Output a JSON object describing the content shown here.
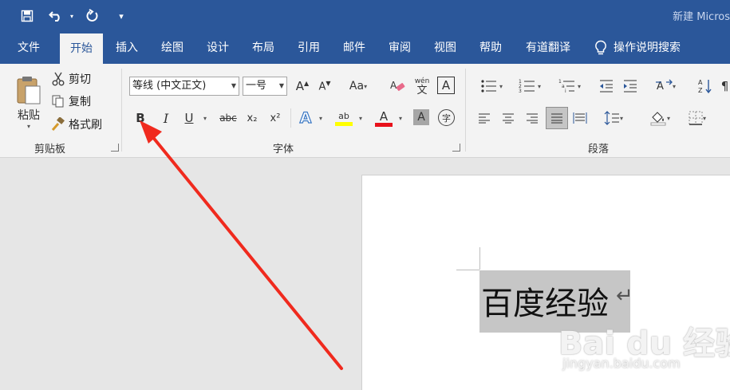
{
  "window": {
    "title": "新建 Micros"
  },
  "tabs": [
    {
      "label": "文件"
    },
    {
      "label": "开始"
    },
    {
      "label": "插入"
    },
    {
      "label": "绘图"
    },
    {
      "label": "设计"
    },
    {
      "label": "布局"
    },
    {
      "label": "引用"
    },
    {
      "label": "邮件"
    },
    {
      "label": "审阅"
    },
    {
      "label": "视图"
    },
    {
      "label": "帮助"
    },
    {
      "label": "有道翻译"
    }
  ],
  "tell_me": "操作说明搜索",
  "clipboard": {
    "paste_label": "粘贴",
    "cut_label": "剪切",
    "copy_label": "复制",
    "format_painter_label": "格式刷",
    "group_label": "剪贴板"
  },
  "font": {
    "font_name": "等线 (中文正文)",
    "font_size": "一号",
    "group_label": "字体",
    "bold": "B",
    "italic": "I",
    "underline": "U",
    "strikethrough": "abc",
    "subscript": "x₂",
    "superscript": "x²",
    "aa_label": "Aa",
    "phonetic_top": "wén",
    "phonetic_bottom": "文",
    "highlight_label": "ab",
    "font_color_label": "A",
    "char_shading_label": "A",
    "enclose_label": "字",
    "text_effect_label": "A",
    "highlight_color": "#ffff00",
    "font_color": "#e8111b"
  },
  "paragraph": {
    "group_label": "段落"
  },
  "document": {
    "text": "百度经验"
  },
  "watermark": {
    "brand": "Bai du 经验",
    "url": "jingyan.baidu.com"
  }
}
